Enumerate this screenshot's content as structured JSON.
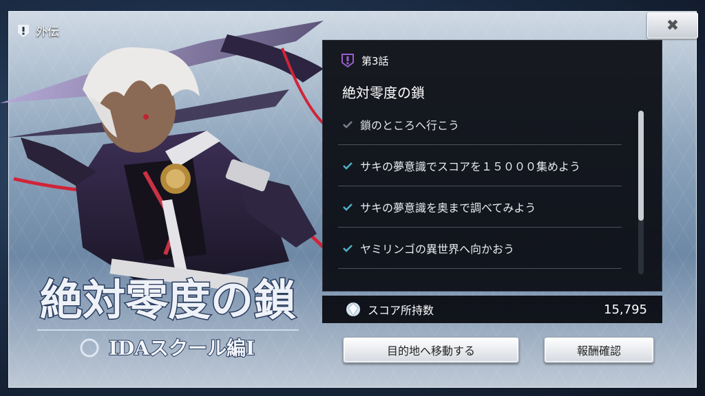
{
  "side_tab": {
    "label": "外伝"
  },
  "chapter": {
    "label": "第3話"
  },
  "quest": {
    "title": "絶対零度の鎖",
    "objectives": [
      {
        "text": "鎖のところへ行こう",
        "completed": false
      },
      {
        "text": "サキの夢意識でスコアを１５０００集めよう",
        "completed": true
      },
      {
        "text": "サキの夢意識を奥まで調べてみよう",
        "completed": true
      },
      {
        "text": "ヤミリンゴの異世界へ向かおう",
        "completed": true
      }
    ]
  },
  "score": {
    "label": "スコア所持数",
    "value": "15,795"
  },
  "buttons": {
    "move": "目的地へ移動する",
    "rewards": "報酬確認",
    "close": "✖"
  },
  "logo": {
    "title": "絶対零度の鎖",
    "subtitle": "IDAスクール編Ⅰ"
  },
  "colors": {
    "accent_purple": "#8a56b8",
    "check_teal": "#4fb3c8",
    "check_dim": "#7a8089"
  }
}
